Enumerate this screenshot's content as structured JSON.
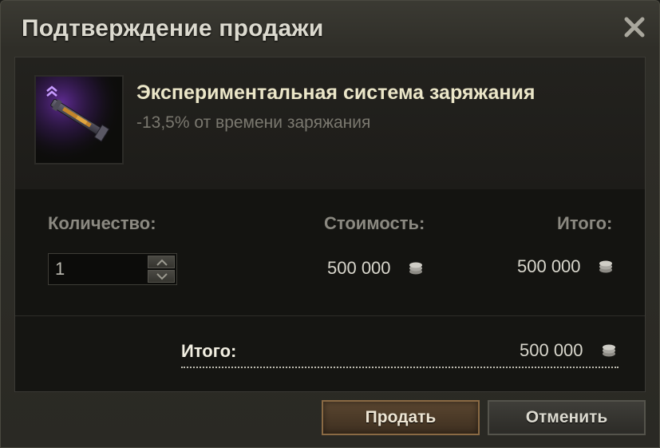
{
  "dialog": {
    "title": "Подтверждение продажи"
  },
  "item": {
    "name": "Экспериментальная система заряжания",
    "description": "-13,5% от времени заряжания",
    "icon": "rammer-equipment-icon"
  },
  "calc": {
    "quantity_label": "Количество:",
    "quantity_value": "1",
    "price_label": "Стоимость:",
    "price_value": "500 000",
    "subtotal_label": "Итого:",
    "subtotal_value": "500 000"
  },
  "total": {
    "label": "Итого:",
    "value": "500 000"
  },
  "buttons": {
    "sell": "Продать",
    "cancel": "Отменить"
  },
  "colors": {
    "accent_button_border": "#8a6a44",
    "icon_glow": "#8a3fd0"
  }
}
